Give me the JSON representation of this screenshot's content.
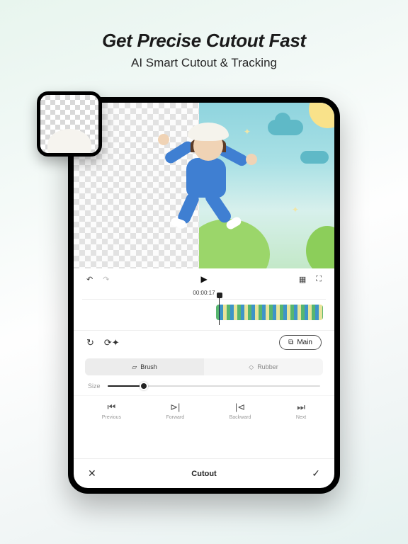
{
  "hero": {
    "title": "Get Precise Cutout Fast",
    "subtitle": "AI Smart Cutout & Tracking"
  },
  "timeline": {
    "timestamp": "00:00:17"
  },
  "main_pill": {
    "label": "Main"
  },
  "tabs": {
    "brush": "Brush",
    "rubber": "Rubber"
  },
  "size": {
    "label": "Size"
  },
  "nav": {
    "previous": "Previous",
    "forward": "Forward",
    "backward": "Backward",
    "next": "Next"
  },
  "bottom": {
    "title": "Cutout"
  }
}
